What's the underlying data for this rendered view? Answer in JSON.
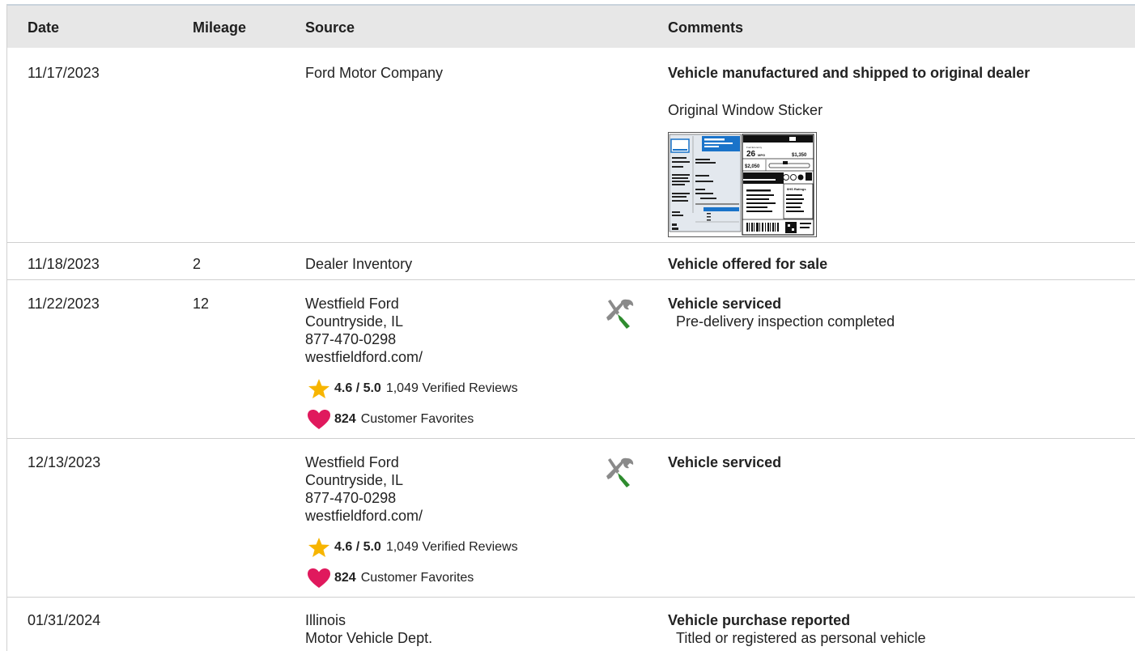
{
  "columns": {
    "date": "Date",
    "mileage": "Mileage",
    "source": "Source",
    "comments": "Comments"
  },
  "rows": [
    {
      "date": "11/17/2023",
      "mileage": "",
      "source_lines": [
        "Ford Motor Company"
      ],
      "comment_title": "Vehicle manufactured and shipped to original dealer",
      "comment_detail": "",
      "link": "Original Window Sticker",
      "sticker": {
        "mpg": "26",
        "mpg_unit": "MPG",
        "price1": "$1,350",
        "price2": "$2,050",
        "ratings": "IIHS Ratings"
      }
    },
    {
      "date": "11/18/2023",
      "mileage": "2",
      "source_lines": [
        "Dealer Inventory"
      ],
      "comment_title": "Vehicle offered for sale",
      "comment_detail": ""
    },
    {
      "date": "11/22/2023",
      "mileage": "12",
      "source_lines": [
        "Westfield Ford",
        "Countryside, IL",
        "877-470-0298",
        "westfieldford.com/"
      ],
      "rating": "4.6 / 5.0",
      "reviews": "1,049 Verified Reviews",
      "favorites_count": "824",
      "favorites_label": "Customer Favorites",
      "comment_title": "Vehicle serviced",
      "comment_detail": "Pre-delivery inspection completed"
    },
    {
      "date": "12/13/2023",
      "mileage": "",
      "source_lines": [
        "Westfield Ford",
        "Countryside, IL",
        "877-470-0298",
        "westfieldford.com/"
      ],
      "rating": "4.6 / 5.0",
      "reviews": "1,049 Verified Reviews",
      "favorites_count": "824",
      "favorites_label": "Customer Favorites",
      "comment_title": "Vehicle serviced",
      "comment_detail": ""
    },
    {
      "date": "01/31/2024",
      "mileage": "",
      "source_lines": [
        "Illinois",
        "Motor Vehicle Dept."
      ],
      "comment_title": "Vehicle purchase reported",
      "comment_detail": "Titled or registered as personal vehicle"
    }
  ],
  "colors": {
    "header_bg": "#e7e7e7",
    "star": "#f7b500",
    "heart": "#e0195d",
    "wrench_green": "#2e8b2e",
    "icon_gray": "#8a8a8a",
    "sticker_blue": "#1a73c9"
  },
  "icons": {
    "service": "wrench-screwdriver-icon",
    "rating": "star-icon",
    "favorites": "heart-icon"
  }
}
